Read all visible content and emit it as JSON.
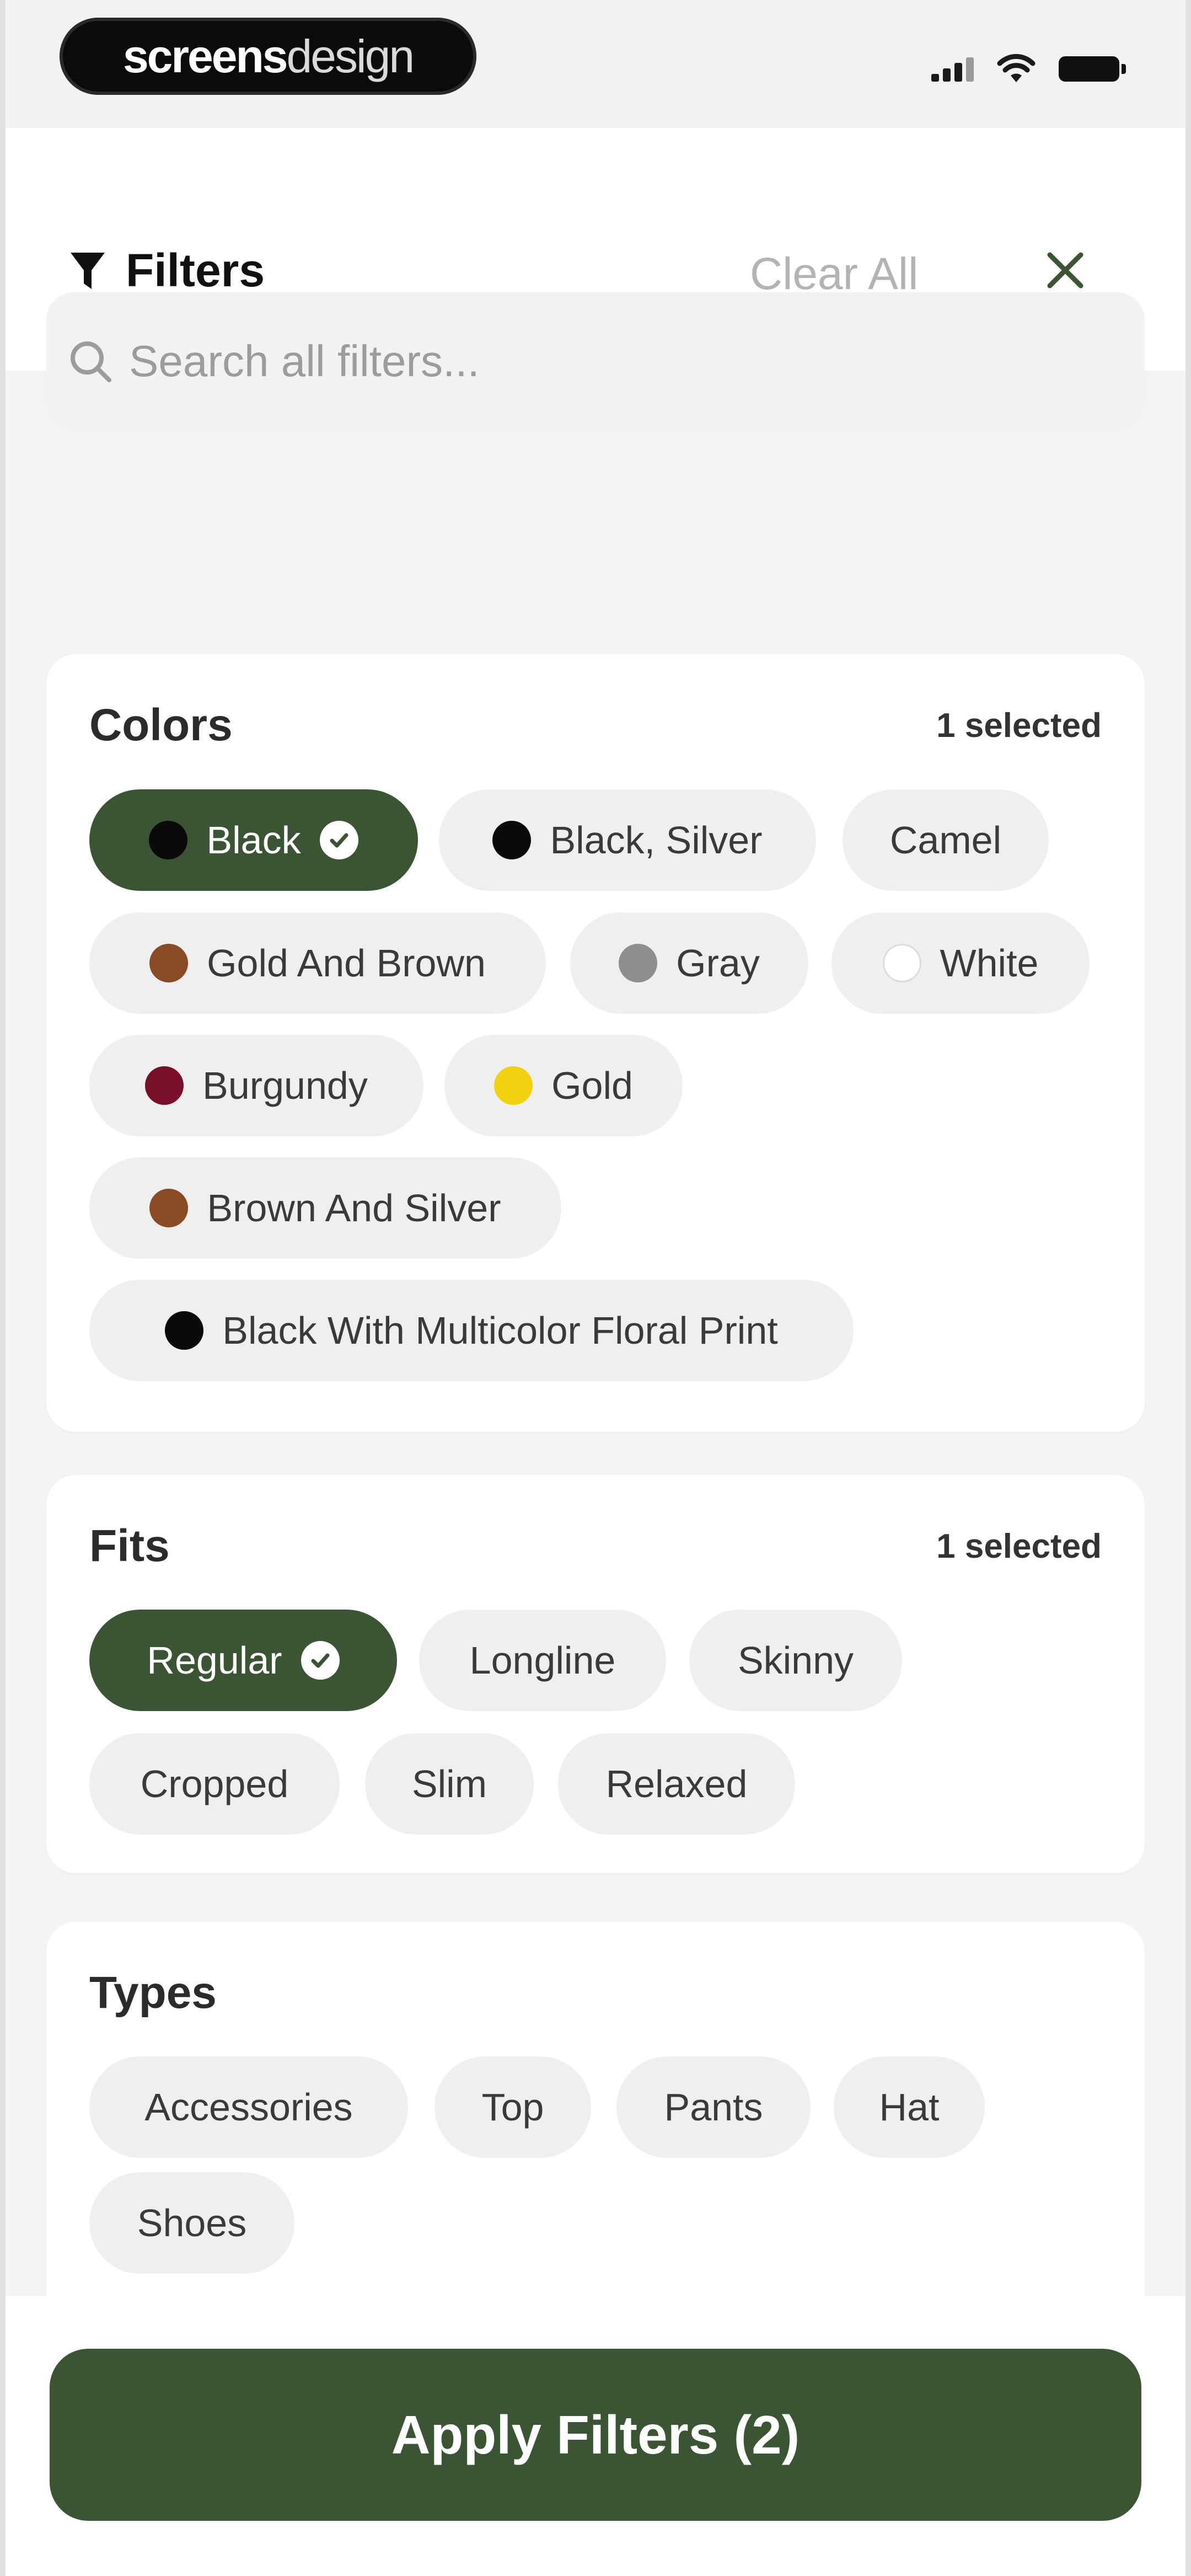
{
  "status_bar": {
    "logo_bold": "screens",
    "logo_light": "design"
  },
  "header": {
    "title": "Filters",
    "clear_all": "Clear All",
    "search_placeholder": "Search all filters..."
  },
  "colors": {
    "title": "Colors",
    "count": "1 selected",
    "chips": [
      {
        "label": "Black",
        "swatch": "#0a0a0a",
        "selected": true
      },
      {
        "label": "Black, Silver",
        "swatch": "#0a0a0a",
        "selected": false
      },
      {
        "label": "Camel",
        "swatch": null,
        "selected": false
      },
      {
        "label": "Gold And Brown",
        "swatch": "#8a4a24",
        "selected": false
      },
      {
        "label": "Gray",
        "swatch": "#8e8e8e",
        "selected": false
      },
      {
        "label": "White",
        "swatch": "#ffffff",
        "selected": false
      },
      {
        "label": "Burgundy",
        "swatch": "#7a0f2a",
        "selected": false
      },
      {
        "label": "Gold",
        "swatch": "#f2d20e",
        "selected": false
      },
      {
        "label": "Brown And Silver",
        "swatch": "#8a4a24",
        "selected": false
      },
      {
        "label": "Black With Multicolor Floral Print",
        "swatch": "#0a0a0a",
        "selected": false
      }
    ]
  },
  "fits": {
    "title": "Fits",
    "count": "1 selected",
    "chips": [
      {
        "label": "Regular",
        "selected": true
      },
      {
        "label": "Longline",
        "selected": false
      },
      {
        "label": "Skinny",
        "selected": false
      },
      {
        "label": "Cropped",
        "selected": false
      },
      {
        "label": "Slim",
        "selected": false
      },
      {
        "label": "Relaxed",
        "selected": false
      }
    ]
  },
  "types": {
    "title": "Types",
    "chips": [
      {
        "label": "Accessories",
        "selected": false
      },
      {
        "label": "Top",
        "selected": false
      },
      {
        "label": "Pants",
        "selected": false
      },
      {
        "label": "Hat",
        "selected": false
      },
      {
        "label": "Shoes",
        "selected": false
      }
    ]
  },
  "footer": {
    "apply_label": "Apply Filters (2)"
  },
  "theme": {
    "accent": "#3b5534",
    "chip_bg": "#efefef",
    "muted_text": "#b3b3b3"
  }
}
